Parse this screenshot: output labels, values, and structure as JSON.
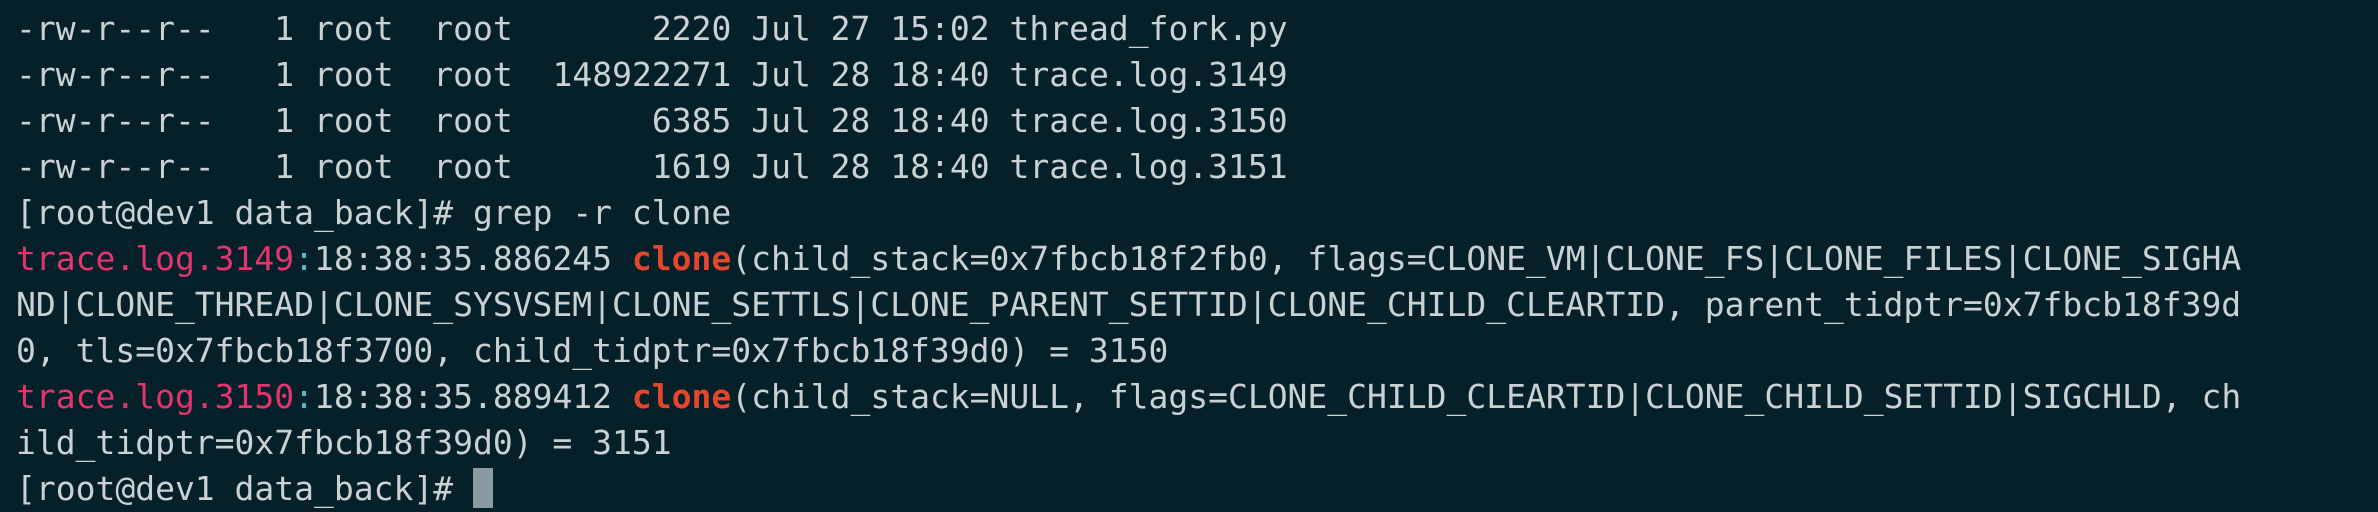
{
  "terminal": {
    "ls_rows": [
      {
        "perms": "-rw-r--r--",
        "links": "1",
        "owner": "root",
        "group": "root",
        "size": "2220",
        "date": "Jul 27 15:02",
        "name": "thread_fork.py"
      },
      {
        "perms": "-rw-r--r--",
        "links": "1",
        "owner": "root",
        "group": "root",
        "size": "148922271",
        "date": "Jul 28 18:40",
        "name": "trace.log.3149"
      },
      {
        "perms": "-rw-r--r--",
        "links": "1",
        "owner": "root",
        "group": "root",
        "size": "6385",
        "date": "Jul 28 18:40",
        "name": "trace.log.3150"
      },
      {
        "perms": "-rw-r--r--",
        "links": "1",
        "owner": "root",
        "group": "root",
        "size": "1619",
        "date": "Jul 28 18:40",
        "name": "trace.log.3151"
      }
    ],
    "prompt": "[root@dev1 data_back]# ",
    "command": "grep -r clone",
    "results": [
      {
        "file": "trace.log.3149",
        "sep": ":",
        "time": "18:38:35.886245 ",
        "match": "clone",
        "line1": "(child_stack=0x7fbcb18f2fb0, flags=CLONE_VM|CLONE_FS|CLONE_FILES|CLONE_SIGHA",
        "line2": "ND|CLONE_THREAD|CLONE_SYSVSEM|CLONE_SETTLS|CLONE_PARENT_SETTID|CLONE_CHILD_CLEARTID, parent_tidptr=0x7fbcb18f39d",
        "line3": "0, tls=0x7fbcb18f3700, child_tidptr=0x7fbcb18f39d0) = 3150"
      },
      {
        "file": "trace.log.3150",
        "sep": ":",
        "time": "18:38:35.889412 ",
        "match": "clone",
        "line1": "(child_stack=NULL, flags=CLONE_CHILD_CLEARTID|CLONE_CHILD_SETTID|SIGCHLD, ch",
        "line2": "ild_tidptr=0x7fbcb18f39d0) = 3151"
      }
    ],
    "final_prompt": "[root@dev1 data_back]# "
  }
}
